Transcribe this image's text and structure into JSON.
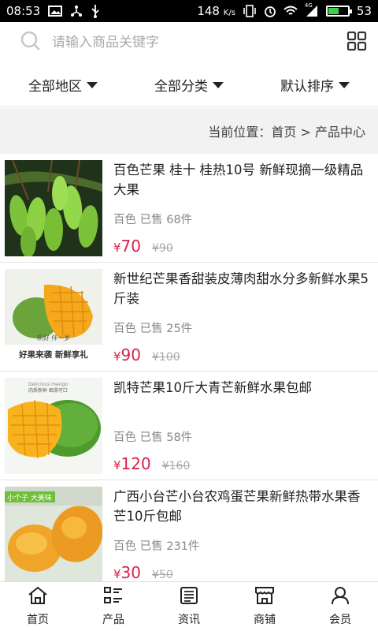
{
  "status_bar": {
    "time": "08:53",
    "speed_value": "148",
    "speed_unit": "K/s",
    "network": "4G",
    "battery": "53",
    "battery_level": 0.53
  },
  "search": {
    "placeholder": "请输入商品关键字"
  },
  "filters": [
    {
      "label": "全部地区"
    },
    {
      "label": "全部分类"
    },
    {
      "label": "默认排序"
    }
  ],
  "breadcrumb": "当前位置：首页 > 产品中心",
  "products": [
    {
      "title": "百色芒果 桂十 桂热10号 新鲜现摘一级精品大果",
      "meta": "百色 已售 68件",
      "currency": "¥",
      "price": "70",
      "old_price": "¥90",
      "image": "green-mangoes-on-tree"
    },
    {
      "title": "新世纪芒果香甜装皮薄肉甜水分多新鲜水果5斤装",
      "meta": "百色 已售 25件",
      "currency": "¥",
      "price": "90",
      "old_price": "¥100",
      "image": "mango-gift-box",
      "image_text": [
        "新好  伴一岁",
        "好果来袭 新鲜享礼"
      ]
    },
    {
      "title": "凯特芒果10斤大青芒新鲜水果包邮",
      "meta": "百色 已售 58件",
      "currency": "¥",
      "price": "120",
      "old_price": "¥160",
      "image": "cut-green-mango",
      "image_text": [
        "Delicious mango",
        "肉质新鲜 细滑可口"
      ]
    },
    {
      "title": "广西小台芒小台农鸡蛋芒果新鲜热带水果香芒10斤包邮",
      "meta": "百色 已售 231件",
      "currency": "¥",
      "price": "30",
      "old_price": "¥50",
      "image": "small-yellow-mangoes",
      "image_text": [
        "小个子 大美味"
      ]
    }
  ],
  "tabs": [
    {
      "label": "首页",
      "icon": "home-icon"
    },
    {
      "label": "产品",
      "icon": "product-list-icon"
    },
    {
      "label": "资讯",
      "icon": "news-icon"
    },
    {
      "label": "商铺",
      "icon": "shop-icon"
    },
    {
      "label": "会员",
      "icon": "member-icon"
    }
  ],
  "colors": {
    "price": "#d9214b",
    "battery": "#3ed04a",
    "breadcrumb_bg": "#f2f2f2"
  }
}
